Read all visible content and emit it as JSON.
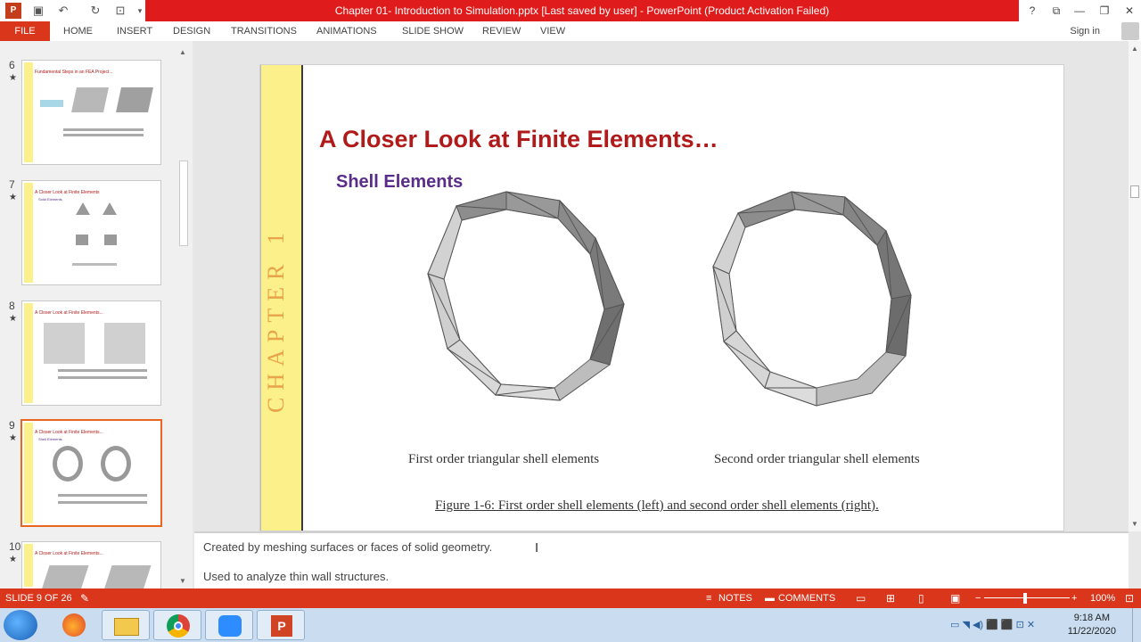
{
  "window": {
    "title": "Chapter 01- Introduction to Simulation.pptx [Last saved by user] -  PowerPoint (Product Activation Failed)",
    "help": "?",
    "controls": [
      "minimize",
      "restore",
      "close"
    ]
  },
  "ribbon": {
    "file": "FILE",
    "tabs": [
      "HOME",
      "INSERT",
      "DESIGN",
      "TRANSITIONS",
      "ANIMATIONS",
      "SLIDE SHOW",
      "REVIEW",
      "VIEW"
    ],
    "sign_in": "Sign in"
  },
  "thumbnails": [
    {
      "num": "6",
      "star": "★",
      "title": "Fundamental Steps in an FEA Project...",
      "subtitle": ""
    },
    {
      "num": "7",
      "star": "★",
      "title": "A Closer Look at Finite Elements",
      "subtitle": "Solid Elements"
    },
    {
      "num": "8",
      "star": "★",
      "title": "A Closer Look at Finite Elements...",
      "subtitle": ""
    },
    {
      "num": "9",
      "star": "★",
      "title": "A Closer Look at Finite Elements...",
      "subtitle": "Shell Elements"
    },
    {
      "num": "10",
      "star": "★",
      "title": "A Closer Look at Finite Elements...",
      "subtitle": ""
    }
  ],
  "slide": {
    "chapter_label": "CHAPTER 1",
    "title": "A Closer Look at Finite Elements…",
    "subtitle": "Shell Elements",
    "caption_left": "First order triangular shell elements",
    "caption_right": "Second order triangular shell elements",
    "figure_caption": "Figure 1-6: First order shell elements (left) and second order shell elements (right)."
  },
  "notes": {
    "line1": "Created by meshing surfaces or faces of solid geometry.",
    "line2": "Used to analyze thin wall structures."
  },
  "status": {
    "slide_counter": "SLIDE 9 OF 26",
    "notes": "NOTES",
    "comments": "COMMENTS",
    "zoom": "100%"
  },
  "taskbar": {
    "apps": [
      "start",
      "firefox",
      "file-explorer",
      "chrome",
      "zoom",
      "powerpoint"
    ],
    "time": "9:18 AM",
    "date": "11/22/2020"
  },
  "colors": {
    "title_bar_red": "#e01b1b",
    "status_orange": "#d9361c",
    "slide_title": "#b01a1a",
    "slide_subtitle": "#5a2d8a",
    "chapter_strip": "#fbf08a"
  }
}
